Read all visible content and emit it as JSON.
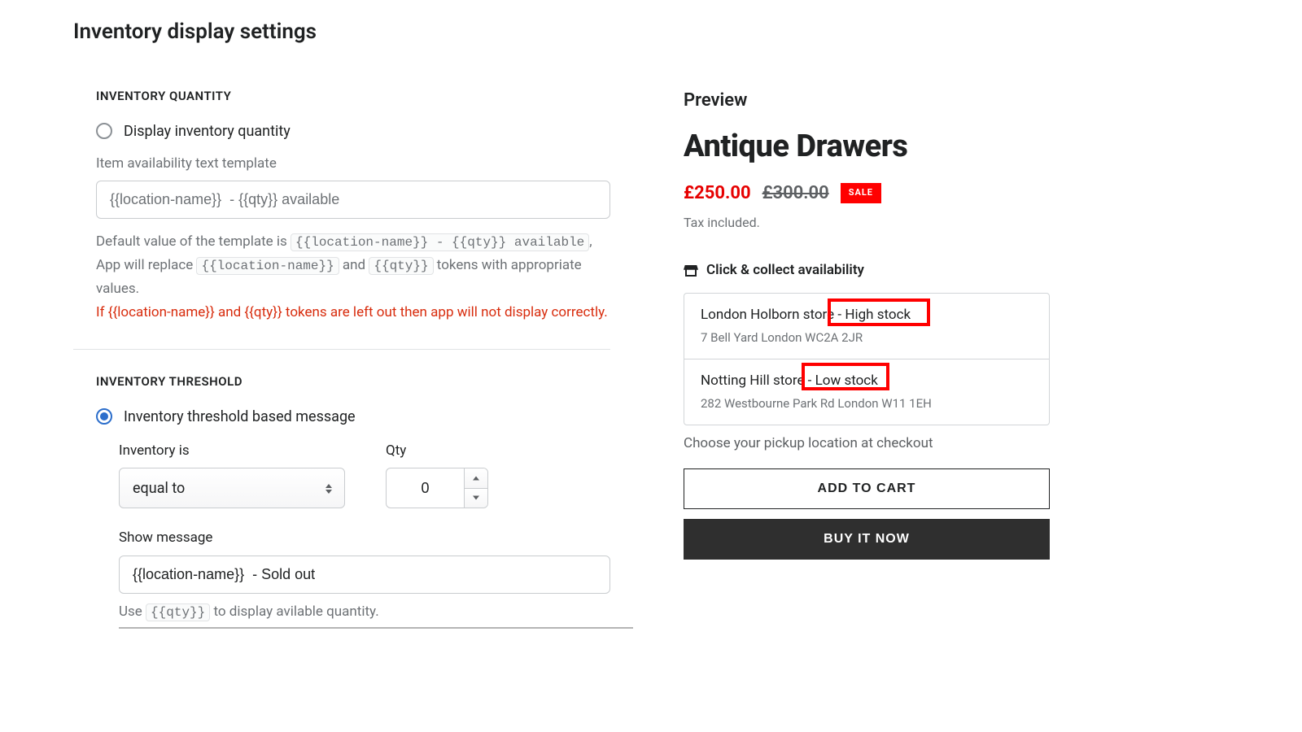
{
  "page_title": "Inventory display settings",
  "quantity": {
    "heading": "INVENTORY QUANTITY",
    "display_label": "Display inventory quantity",
    "display_selected": false,
    "template_label": "Item availability text template",
    "template_value": "{{location-name}}  - {{qty}} available",
    "help_line1_pre": "Default value of the template is ",
    "tok_full": "{{location-name}} - {{qty}} available",
    "help_line1_post": ", App will replace ",
    "tok_loc": "{{location-name}}",
    "help_and": " and ",
    "tok_qty": "{{qty}}",
    "help_post2": "  tokens with appropriate values.",
    "warning": "If {{location-name}} and {{qty}} tokens are left out then app will not display correctly."
  },
  "threshold": {
    "heading": "INVENTORY THRESHOLD",
    "radio_label": "Inventory threshold based message",
    "radio_selected": true,
    "inv_label": "Inventory is",
    "inv_value": "equal to",
    "qty_label": "Qty",
    "qty_value": "0",
    "show_label": "Show message",
    "show_value": "{{location-name}}  - Sold out",
    "use_pre": "Use ",
    "use_tok": "{{qty}}",
    "use_post": " to display avilable quantity."
  },
  "preview": {
    "heading": "Preview",
    "product": "Antique Drawers",
    "price": "£250.00",
    "compare": "£300.00",
    "sale": "SALE",
    "tax": "Tax included.",
    "cc_title": "Click & collect availability",
    "locations": [
      {
        "name": "London Holborn store",
        "stock_suffix": " - High stock",
        "addr": "7 Bell Yard London WC2A 2JR"
      },
      {
        "name": "Notting Hill store",
        "stock_suffix": " - Low stock",
        "addr": "282 Westbourne Park Rd London W11 1EH"
      }
    ],
    "pickup_note": "Choose your pickup location at checkout",
    "atc": "ADD TO CART",
    "buy": "BUY IT NOW"
  }
}
